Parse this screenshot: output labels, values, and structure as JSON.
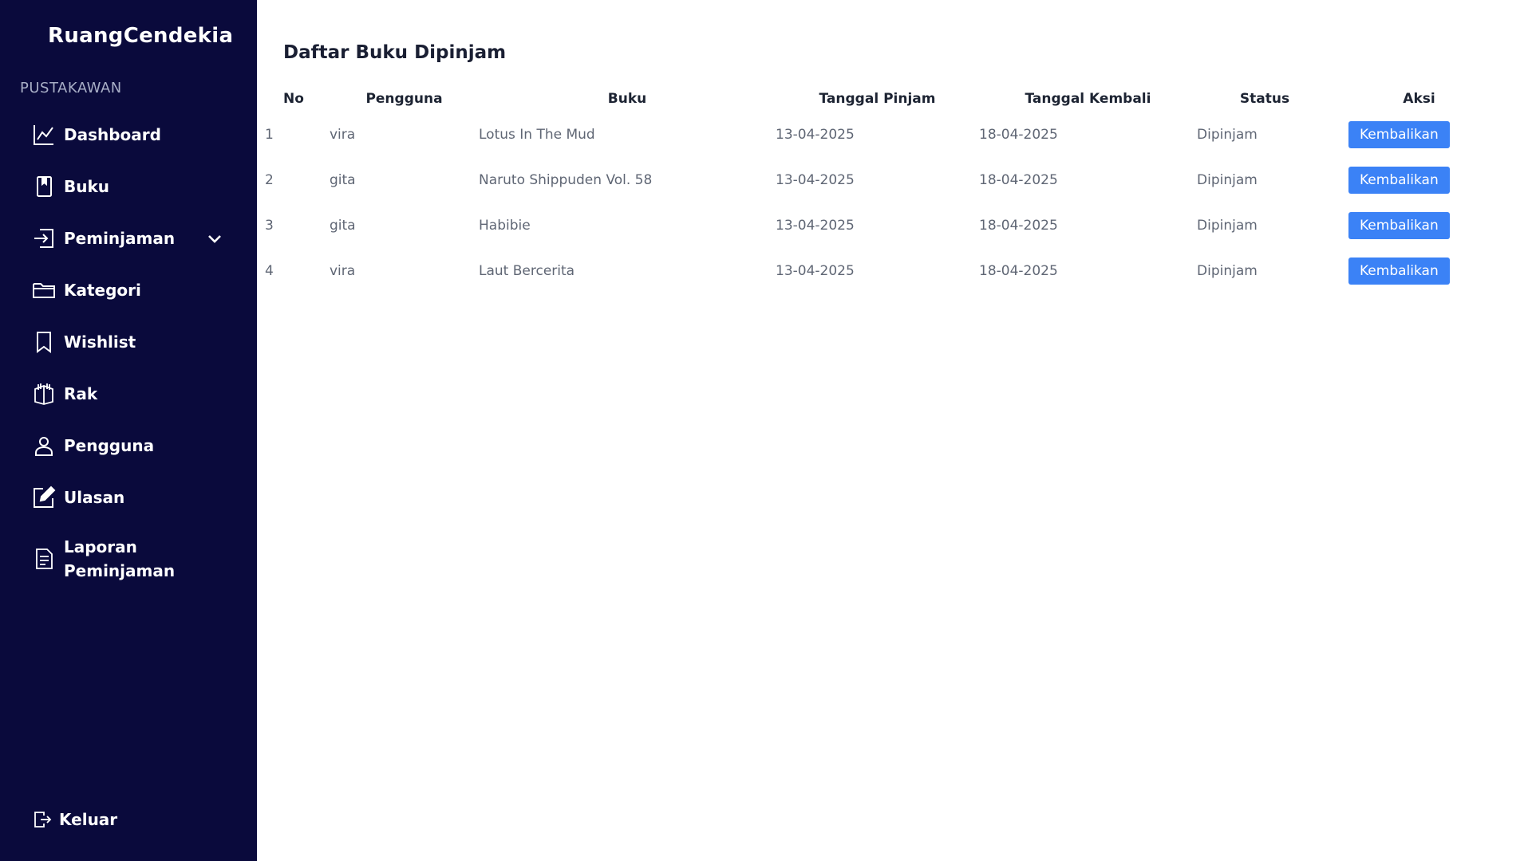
{
  "app": {
    "brand": "RuangCendekia",
    "section_label": "PUSTAKAWAN"
  },
  "sidebar": {
    "items": [
      {
        "label": "Dashboard",
        "icon": "chart-line-icon"
      },
      {
        "label": "Buku",
        "icon": "book-icon"
      },
      {
        "label": "Peminjaman",
        "icon": "sign-in-icon",
        "has_dropdown": true
      },
      {
        "label": "Kategori",
        "icon": "folder-icon"
      },
      {
        "label": "Wishlist",
        "icon": "bookmark-icon"
      },
      {
        "label": "Rak",
        "icon": "bookshelf-icon"
      },
      {
        "label": "Pengguna",
        "icon": "user-icon"
      },
      {
        "label": "Ulasan",
        "icon": "edit-icon"
      },
      {
        "label": "Laporan Peminjaman",
        "icon": "report-icon"
      }
    ],
    "logout": {
      "label": "Keluar",
      "icon": "logout-icon"
    }
  },
  "main": {
    "title": "Daftar Buku Dipinjam",
    "table": {
      "headers": [
        "No",
        "Pengguna",
        "Buku",
        "Tanggal Pinjam",
        "Tanggal Kembali",
        "Status",
        "Aksi"
      ],
      "rows": [
        {
          "no": "1",
          "user": "vira",
          "book": "Lotus In The Mud",
          "pinjam": "13-04-2025",
          "kembali": "18-04-2025",
          "status": "Dipinjam",
          "action": "Kembalikan"
        },
        {
          "no": "2",
          "user": "gita",
          "book": "Naruto Shippuden Vol. 58",
          "pinjam": "13-04-2025",
          "kembali": "18-04-2025",
          "status": "Dipinjam",
          "action": "Kembalikan"
        },
        {
          "no": "3",
          "user": "gita",
          "book": "Habibie",
          "pinjam": "13-04-2025",
          "kembali": "18-04-2025",
          "status": "Dipinjam",
          "action": "Kembalikan"
        },
        {
          "no": "4",
          "user": "vira",
          "book": "Laut Bercerita",
          "pinjam": "13-04-2025",
          "kembali": "18-04-2025",
          "status": "Dipinjam",
          "action": "Kembalikan"
        }
      ]
    }
  },
  "colors": {
    "sidebar_bg": "#0a0a3c",
    "accent": "#3b82f6",
    "heading": "#1a1f33",
    "cell_text": "#5f6674"
  }
}
